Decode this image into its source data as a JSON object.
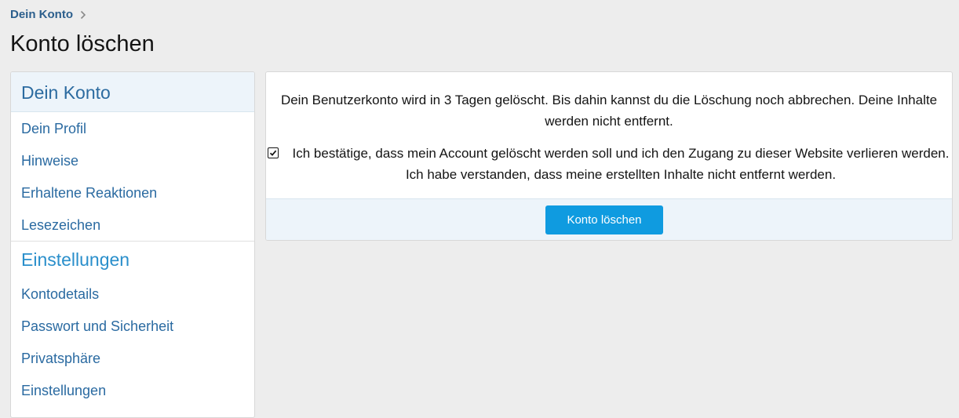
{
  "breadcrumb": {
    "link_label": "Dein Konto",
    "separator_icon": "chevron-right-icon"
  },
  "page": {
    "title": "Konto löschen"
  },
  "sidebar": {
    "sections": [
      {
        "header": "Dein Konto",
        "items": [
          "Dein Profil",
          "Hinweise",
          "Erhaltene Reaktionen",
          "Lesezeichen"
        ]
      },
      {
        "header": "Einstellungen",
        "items": [
          "Kontodetails",
          "Passwort und Sicherheit",
          "Privatsphäre",
          "Einstellungen"
        ]
      }
    ]
  },
  "main": {
    "notice": "Dein Benutzerkonto wird in 3 Tagen gelöscht. Bis dahin kannst du die Löschung noch abbrechen. Deine Inhalte werden nicht entfernt.",
    "confirm": {
      "checked": true,
      "label": "Ich bestätige, dass mein Account gelöscht werden soll und ich den Zugang zu dieser Website verlieren werden. Ich habe verstanden, dass meine erstellten Inhalte nicht entfernt werden."
    },
    "submit_label": "Konto löschen"
  },
  "colors": {
    "page_background": "#ededed",
    "link_blue": "#2a6aa1",
    "accent_button": "#0f9be0",
    "footer_tint": "#edf4fa"
  }
}
